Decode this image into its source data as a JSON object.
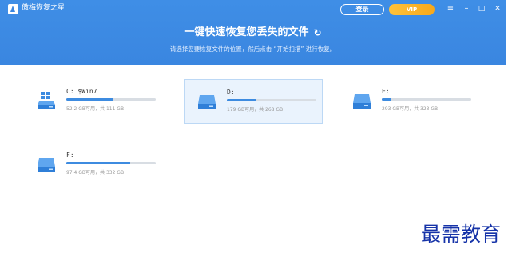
{
  "app": {
    "title": "傲梅恢复之星"
  },
  "title_bar": {
    "login_label": "登录",
    "vip_label": "VIP",
    "menu_icon": "≡",
    "minimize_icon": "–",
    "maximize_icon": "□",
    "close_icon": "✕"
  },
  "hero": {
    "title": "一键快速恢复您丢失的文件",
    "refresh_icon": "↻",
    "subtitle": "请选择您要恢复文件的位置，然后点击 “开始扫描” 进行恢复。"
  },
  "drives": [
    {
      "name": "C: $Win7",
      "usage": "52.2 GB可用，共 111 GB",
      "used_fraction": 0.53,
      "icon": "windows-drive-icon"
    },
    {
      "name": "D:",
      "usage": "179 GB可用，共 268 GB",
      "used_fraction": 0.33,
      "icon": "drive-icon",
      "selected": true
    },
    {
      "name": "E:",
      "usage": "293 GB可用，共 323 GB",
      "used_fraction": 0.1,
      "icon": "drive-icon"
    },
    {
      "name": "F:",
      "usage": "97.4 GB可用，共 332 GB",
      "used_fraction": 0.71,
      "icon": "drive-icon"
    }
  ],
  "watermark": "最需教育",
  "colors": {
    "header": "#3a86e0",
    "accent": "#3d8be0",
    "vip": "#f6a81c",
    "watermark": "#1633a8"
  }
}
